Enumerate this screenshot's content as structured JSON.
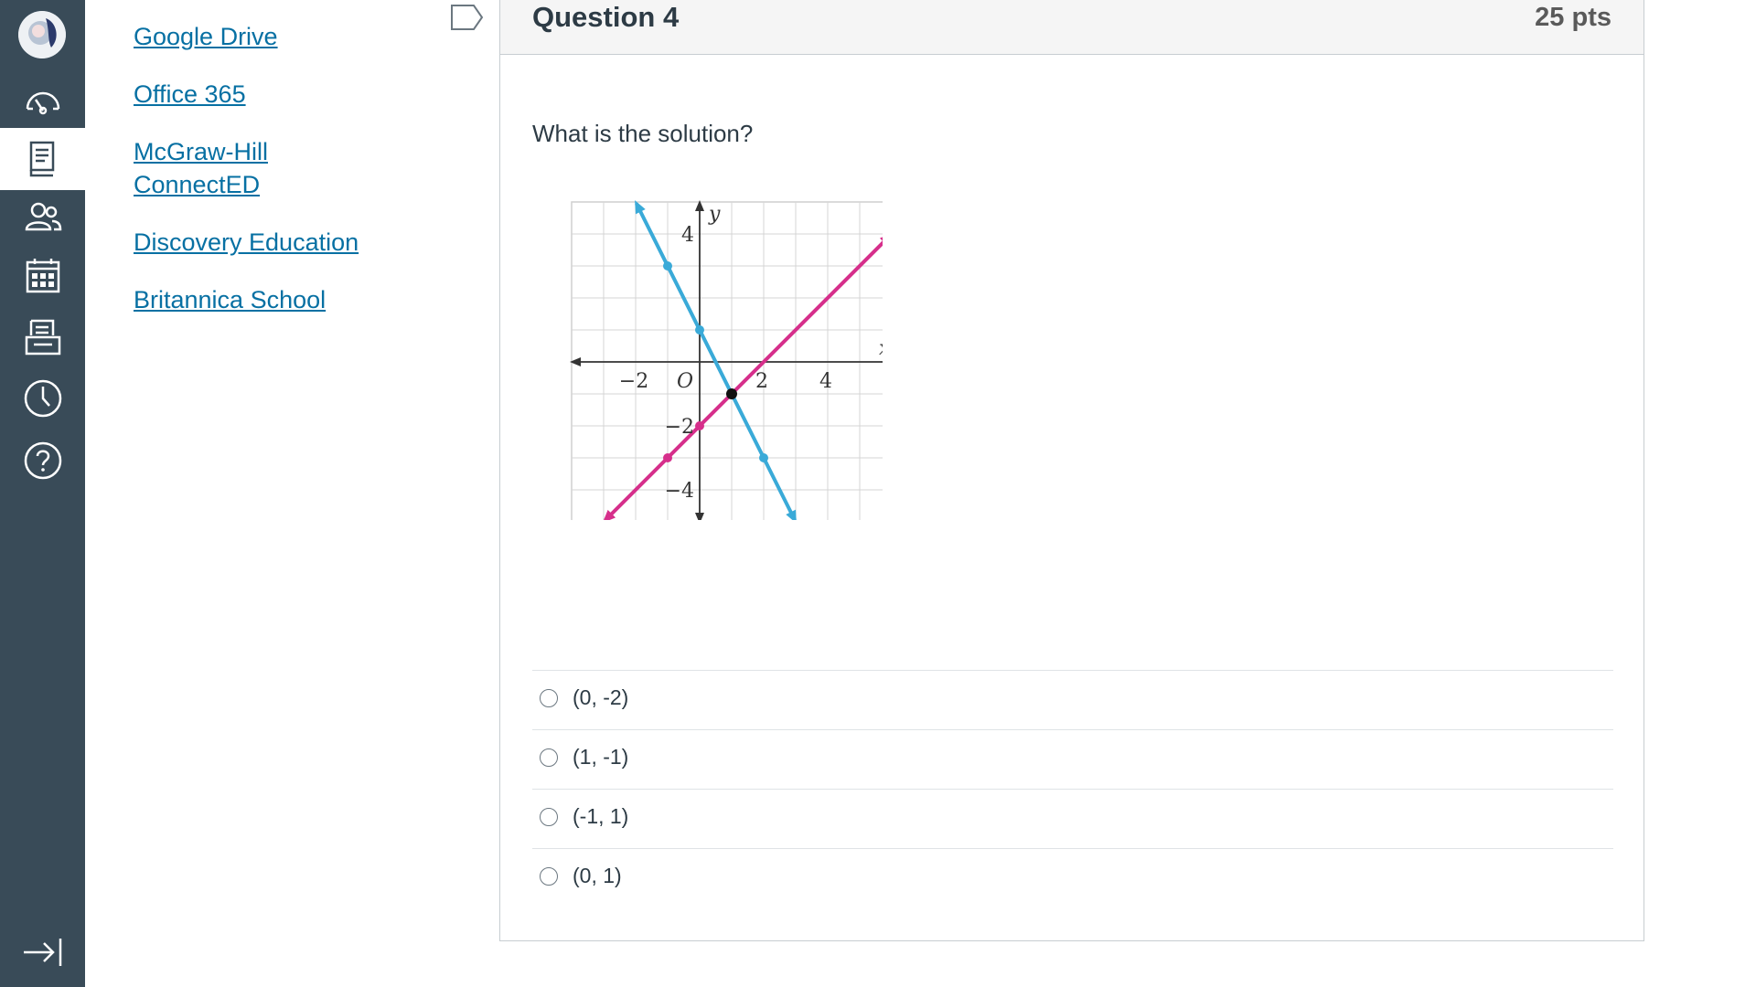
{
  "nav": {
    "items": [
      {
        "icon": "avatar"
      },
      {
        "icon": "dashboard-icon"
      },
      {
        "icon": "courses-icon",
        "active": true
      },
      {
        "icon": "groups-icon"
      },
      {
        "icon": "calendar-icon"
      },
      {
        "icon": "inbox-icon"
      },
      {
        "icon": "history-icon"
      },
      {
        "icon": "help-icon"
      },
      {
        "icon": "collapse-nav-icon"
      }
    ]
  },
  "links": [
    {
      "label": "Google Drive"
    },
    {
      "label": "Office 365"
    },
    {
      "label": "McGraw-Hill ConnectED"
    },
    {
      "label": "Discovery Education"
    },
    {
      "label": "Britannica School"
    }
  ],
  "question": {
    "title": "Question 4",
    "points": "25 pts",
    "text": "What is the solution?",
    "answers": [
      {
        "label": "(0, -2)"
      },
      {
        "label": "(1, -1)"
      },
      {
        "label": "(-1, 1)"
      },
      {
        "label": "(0, 1)"
      }
    ]
  },
  "chart_data": {
    "type": "line",
    "xlabel": "x",
    "ylabel": "y",
    "xlim": [
      -4,
      6
    ],
    "ylim": [
      -5,
      5
    ],
    "x_ticks": [
      "−2",
      "O",
      "2",
      "4"
    ],
    "y_ticks": [
      "4",
      "−2",
      "−4"
    ],
    "grid": true,
    "series": [
      {
        "color": "#3aaad8",
        "points": [
          [
            -1,
            3
          ],
          [
            0,
            1
          ],
          [
            1,
            -1
          ],
          [
            2,
            -3
          ]
        ]
      },
      {
        "color": "#d62f8b",
        "points": [
          [
            -1,
            -3
          ],
          [
            0,
            -2
          ],
          [
            1,
            -1
          ]
        ]
      }
    ],
    "intersection": [
      1,
      -1
    ]
  }
}
